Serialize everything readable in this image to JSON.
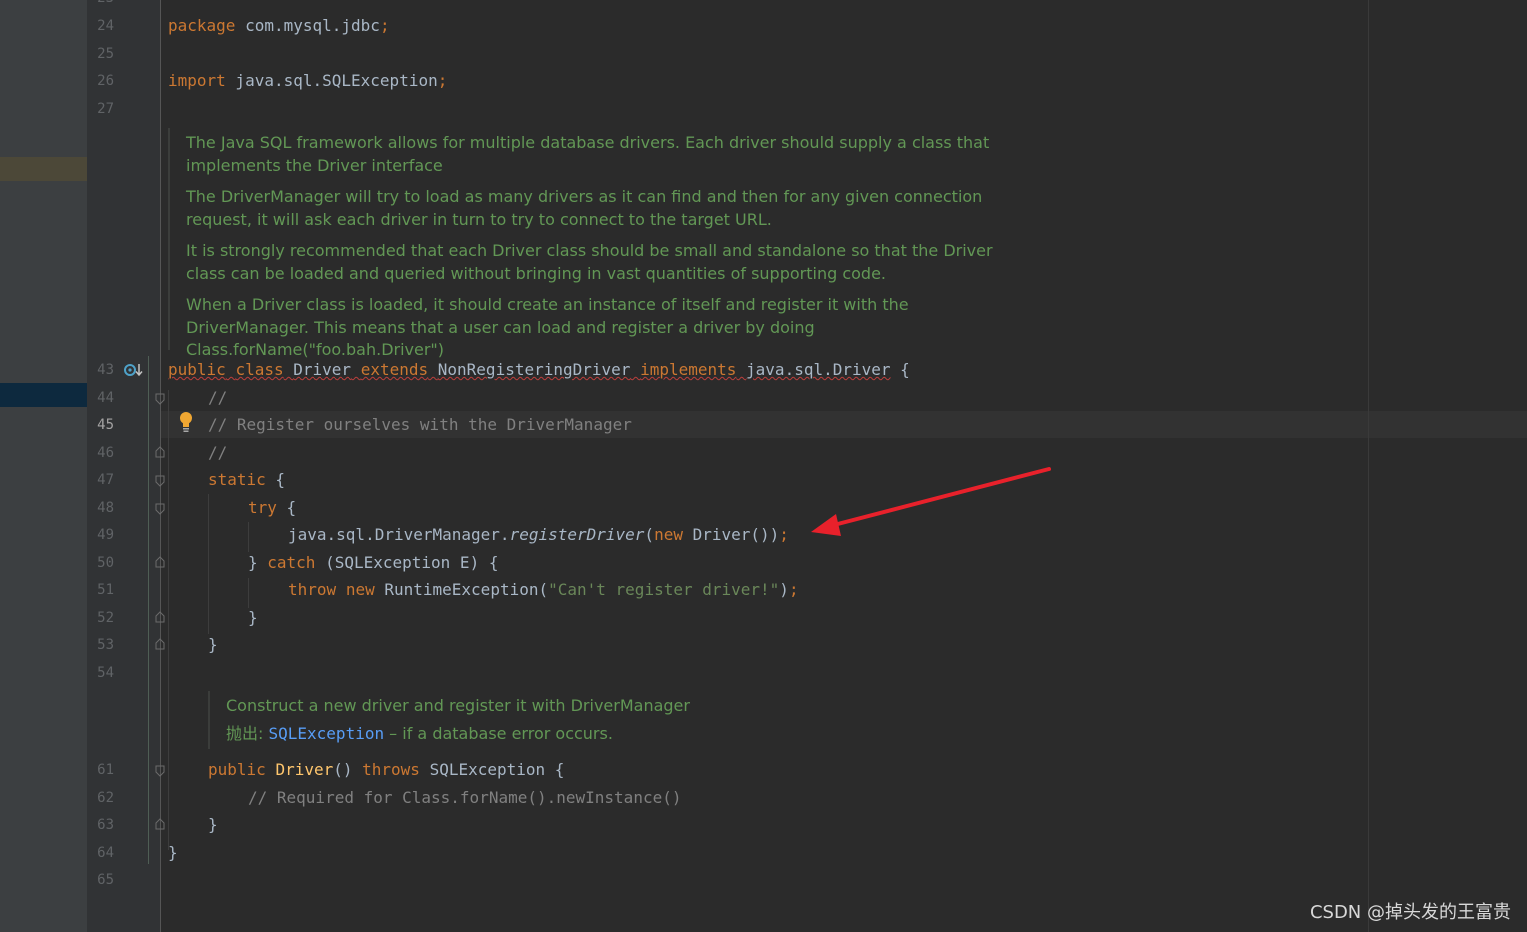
{
  "gutter": {
    "line_numbers": [
      "24",
      "25",
      "26",
      "27",
      "43",
      "44",
      "45",
      "46",
      "47",
      "48",
      "49",
      "50",
      "51",
      "52",
      "53",
      "54",
      "61",
      "62",
      "63",
      "64",
      "65"
    ],
    "current_line": "45"
  },
  "code": {
    "l24": {
      "kw": "package",
      "rest": " com.mysql.jdbc",
      "semi": ";"
    },
    "l26": {
      "kw": "import",
      "rest": " java.sql.SQLException",
      "semi": ";"
    },
    "javadoc_class": [
      "The Java SQL framework allows for multiple database drivers. Each driver should supply a class that implements the Driver interface",
      "The DriverManager will try to load as many drivers as it can find and then for any given connection request, it will ask each driver in turn to try to connect to the target URL.",
      "It is strongly recommended that each Driver class should be small and standalone so that the Driver class can be loaded and queried without bringing in vast quantities of supporting code.",
      "When a Driver class is loaded, it should create an instance of itself and register it with the DriverManager. This means that a user can load and register a driver by doing Class.forName(\"foo.bah.Driver\")"
    ],
    "l43": {
      "kw1": "public",
      "kw2": "class",
      "name": "Driver",
      "kw3": "extends",
      "parent": "NonRegisteringDriver",
      "kw4": "implements",
      "iface": "java.sql.Driver",
      "brace": " {"
    },
    "l44": "//",
    "l45": "// Register ourselves with the DriverManager",
    "l46": "//",
    "l47": {
      "kw": "static",
      "rest": " {"
    },
    "l48": {
      "kw": "try",
      "rest": " {"
    },
    "l49": {
      "prefix": "java.sql.DriverManager.",
      "method": "registerDriver",
      "open": "(",
      "kw": "new",
      "rest": " Driver())",
      "semi": ";"
    },
    "l50": {
      "pre": "} ",
      "kw": "catch",
      "rest": " (SQLException E) {"
    },
    "l51": {
      "kw1": "throw",
      "kw2": "new",
      "mid": " RuntimeException(",
      "str": "\"Can't register driver!\"",
      "end": ")",
      "semi": ";"
    },
    "l52": "}",
    "l53": "}",
    "javadoc_ctor": {
      "desc": "Construct a new driver and register it with DriverManager",
      "throws_label": "抛出:",
      "throws_type": "SQLException",
      "throws_desc": " – if a database error occurs."
    },
    "l61": {
      "kw1": "public",
      "name": "Driver",
      "parens": "()",
      "kw2": "throws",
      "rest": " SQLException {"
    },
    "l62": "// Required for Class.forName().newInstance()",
    "l63": "}",
    "l64": "}"
  },
  "icons": {
    "implement": "implement-interface-icon",
    "bulb": "intention-bulb-icon",
    "fold": "fold-marker-icon",
    "arrow": "red-annotation-arrow"
  },
  "colors": {
    "keyword": "#cc7832",
    "comment": "#808080",
    "doc": "#629755",
    "string": "#6a8759",
    "arrow": "#e8212b"
  },
  "watermark": "CSDN @掉头发的王富贵"
}
